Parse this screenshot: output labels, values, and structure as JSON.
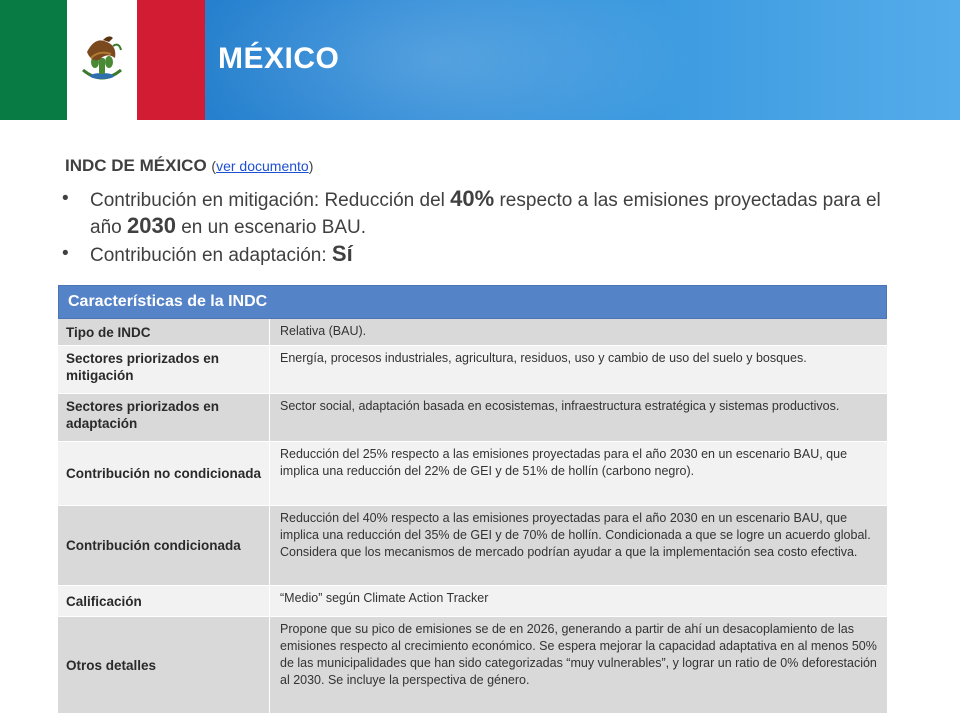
{
  "header": {
    "title": "MÉXICO",
    "flag_colors": {
      "green": "#087a43",
      "white": "#ffffff",
      "red": "#d21c34"
    },
    "emblem_icon": "mexico-coat-of-arms-icon"
  },
  "indc": {
    "heading": "INDC DE MÉXICO",
    "paren_open": "(",
    "link_text": "ver documento",
    "paren_close": ")"
  },
  "bullets": [
    {
      "parts": [
        "Contribución en mitigación: Reducción del ",
        "40%",
        " respecto a las emisiones proyectadas para el año ",
        "2030",
        " en un escenario BAU."
      ]
    },
    {
      "parts": [
        "Contribución en adaptación: ",
        "Sí"
      ]
    }
  ],
  "table": {
    "title": "Características de la INDC",
    "header_color": "#5583c7",
    "rows": [
      {
        "key": "Tipo de INDC",
        "value": "Relativa (BAU)."
      },
      {
        "key": "Sectores priorizados en mitigación",
        "value": "Energía, procesos industriales, agricultura, residuos, uso y cambio de uso del suelo y bosques."
      },
      {
        "key": "Sectores priorizados en adaptación",
        "value": "Sector social, adaptación basada en ecosistemas, infraestructura estratégica y sistemas productivos."
      },
      {
        "key": "Contribución no condicionada",
        "value": "Reducción del 25% respecto a las emisiones proyectadas para el año 2030 en un escenario BAU, que implica una reducción del 22% de GEI y de 51% de hollín (carbono negro)."
      },
      {
        "key": "Contribución condicionada",
        "value": "Reducción del 40% respecto a las emisiones proyectadas para el año 2030 en un escenario BAU, que implica una reducción del 35% de GEI y de 70% de hollín. Condicionada a que se logre un acuerdo global. Considera que los mecanismos de mercado podrían ayudar a que la implementación sea costo efectiva."
      },
      {
        "key": "Calificación",
        "value": "“Medio” según Climate Action Tracker"
      },
      {
        "key": "Otros detalles",
        "value": "Propone que su pico de emisiones se de en 2026, generando a partir de ahí un desacoplamiento de las emisiones respecto al crecimiento económico. Se espera mejorar la capacidad adaptativa en al menos 50% de las municipalidades que han sido categorizadas “muy vulnerables”, y lograr un ratio de 0% deforestación al 2030. Se incluye la perspectiva de género."
      }
    ]
  }
}
